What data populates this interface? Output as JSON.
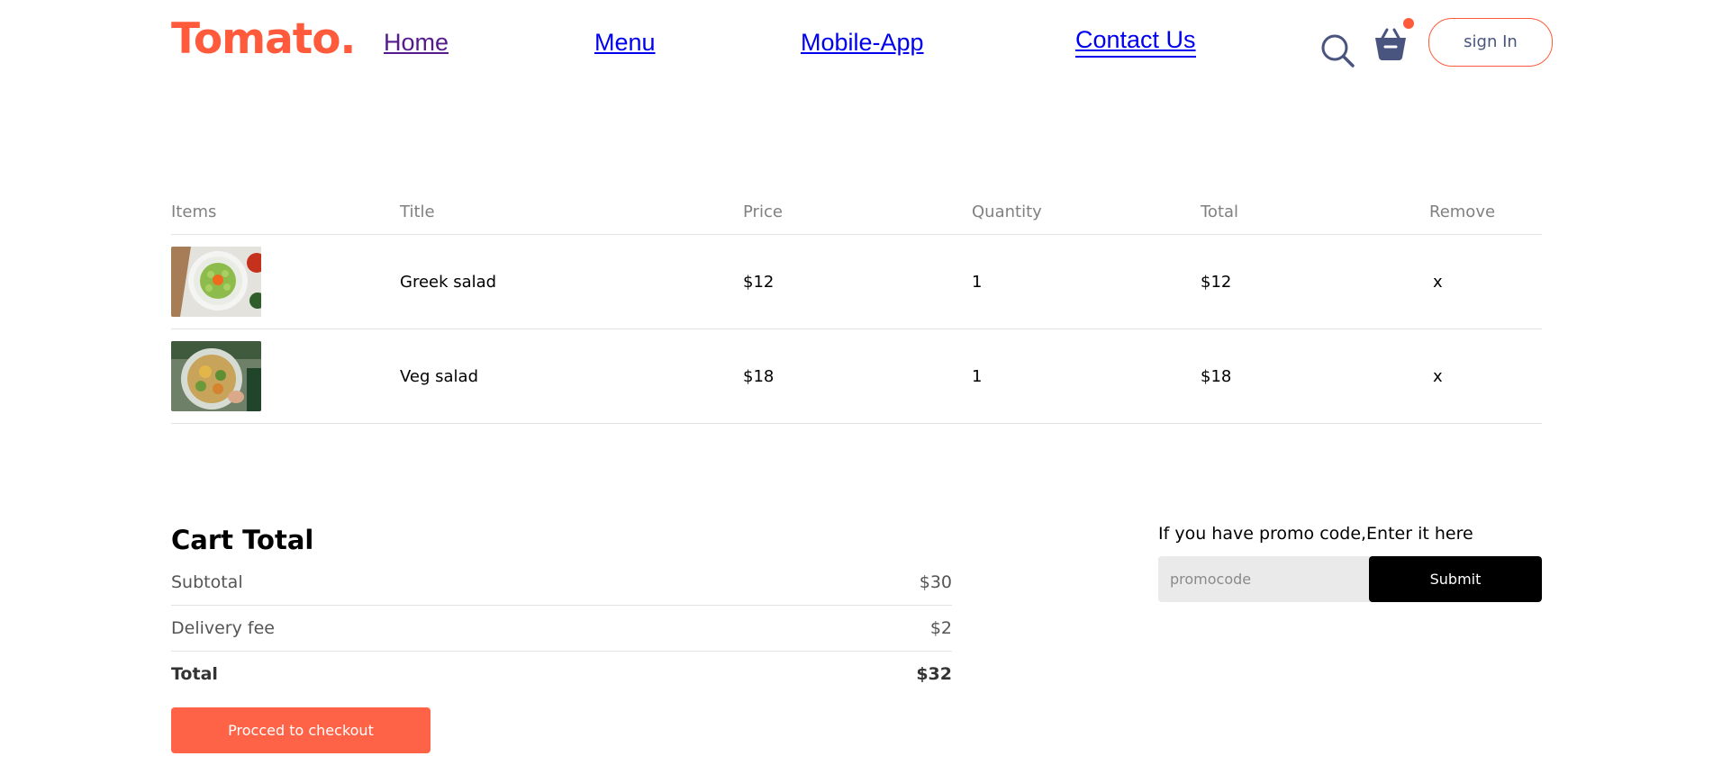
{
  "navbar": {
    "logo": "Tomato.",
    "links": {
      "home": "Home",
      "menu": "Menu",
      "mobile_app": "Mobile-App",
      "contact": "Contact Us"
    },
    "signin_label": "sign In",
    "accent_color": "#ff5a3c"
  },
  "cart": {
    "headers": [
      "Items",
      "Title",
      "Price",
      "Quantity",
      "Total",
      "Remove"
    ],
    "items": [
      {
        "title": "Greek salad",
        "price": "$12",
        "quantity": "1",
        "total": "$12",
        "remove": "x"
      },
      {
        "title": "Veg salad",
        "price": "$18",
        "quantity": "1",
        "total": "$18",
        "remove": "x"
      }
    ]
  },
  "cart_total": {
    "heading": "Cart Total",
    "subtotal_label": "Subtotal",
    "subtotal_value": "$30",
    "delivery_label": "Delivery fee",
    "delivery_value": "$2",
    "total_label": "Total",
    "total_value": "$32",
    "checkout_label": "Procced to checkout",
    "checkout_color": "#ff6347"
  },
  "promo": {
    "prompt": "If you have promo code,Enter it here",
    "placeholder": "promocode",
    "submit_label": "Submit"
  }
}
